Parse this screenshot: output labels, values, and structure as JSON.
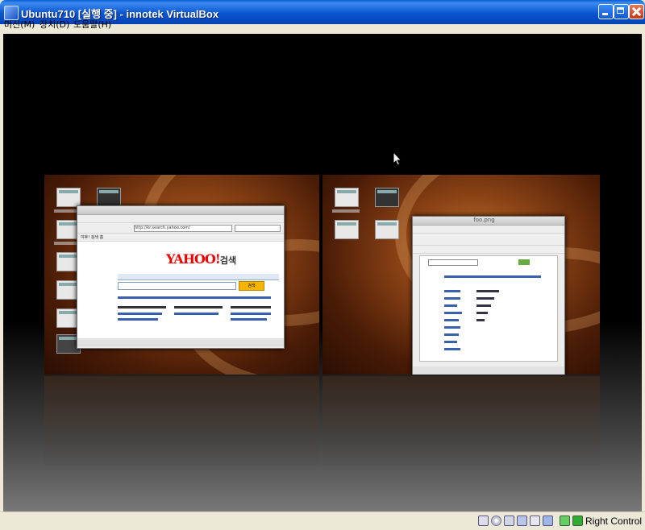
{
  "window": {
    "title": "Ubuntu710 [실행 중] - innotek VirtualBox",
    "controls": {
      "minimize": "minimize",
      "maximize": "maximize",
      "close": "close"
    }
  },
  "menu": {
    "items": [
      {
        "label": "머신(M)"
      },
      {
        "label": "장치(D)"
      },
      {
        "label": "도움말(H)"
      }
    ]
  },
  "vm_screen": {
    "left_workspace": {
      "browser_tab": "야후! 검색 홈",
      "address": "http://kr.search.yahoo.com/",
      "logo": "YAHOO!",
      "logo_suffix": "검색",
      "search_button": "검색"
    },
    "right_workspace": {
      "window_title": "foo.png"
    }
  },
  "statusbar": {
    "host_key": "Right Control",
    "icons": [
      "hdd-icon",
      "cd-icon",
      "floppy-icon",
      "network-icon",
      "usb-icon",
      "shared-folder-icon",
      "mouse-integration-icon",
      "host-key-icon"
    ]
  }
}
